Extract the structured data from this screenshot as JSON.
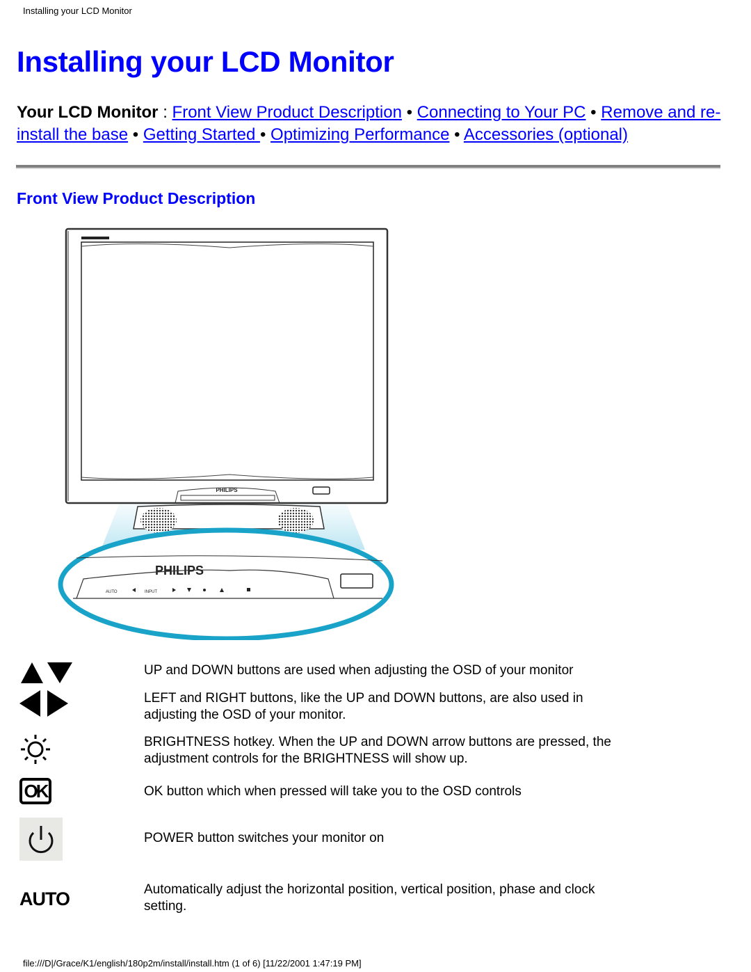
{
  "header": {
    "title": "Installing your LCD Monitor"
  },
  "page_title": "Installing your LCD Monitor",
  "nav": {
    "lead": "Your LCD Monitor",
    "separator": " : ",
    "bullet": " • ",
    "links": [
      "Front View Product Description",
      "Connecting to Your PC",
      "Remove and re-install the base",
      "Getting Started ",
      "Optimizing Performance",
      "Accessories (optional)"
    ]
  },
  "section_title": "Front View Product Description",
  "figure": {
    "brand_label": "PHILIPS",
    "zoom_brand_label": "PHILIPS",
    "button_labels": [
      "AUTO",
      "INPUT"
    ],
    "accent_color": "#1aa3c8"
  },
  "buttons": [
    {
      "icon": "up-down-arrows-icon",
      "description": "UP and DOWN buttons are used when adjusting the OSD of your monitor"
    },
    {
      "icon": "left-right-arrows-icon",
      "description": "LEFT and RIGHT buttons, like the UP and DOWN buttons, are also used in adjusting the OSD of your monitor."
    },
    {
      "icon": "brightness-icon",
      "description": "BRIGHTNESS hotkey. When the UP and DOWN arrow buttons are pressed, the adjustment controls for the BRIGHTNESS will show up."
    },
    {
      "icon": "ok-icon",
      "label": "OK",
      "description": "OK button which when pressed will take you to the OSD controls"
    },
    {
      "icon": "power-icon",
      "description": "POWER button switches your monitor on"
    },
    {
      "icon": "auto-icon",
      "label": "AUTO",
      "description": "Automatically adjust the horizontal position, vertical position, phase and clock setting."
    }
  ],
  "footer": {
    "text": "file:///D|/Grace/K1/english/180p2m/install/install.htm (1 of 6) [11/22/2001 1:47:19 PM]"
  }
}
